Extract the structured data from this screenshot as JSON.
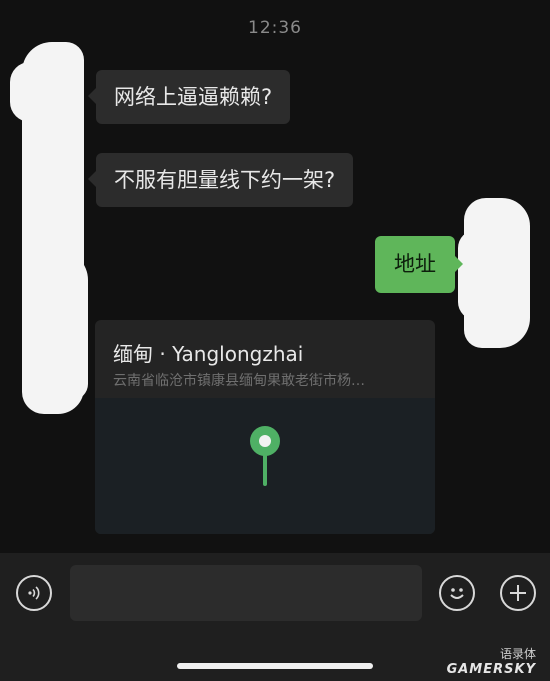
{
  "status_bar": {
    "time": "12:36"
  },
  "messages": [
    {
      "side": "left",
      "text": "网络上逼逼赖赖?"
    },
    {
      "side": "left",
      "text": "不服有胆量线下约一架?"
    },
    {
      "side": "right",
      "text": "地址"
    }
  ],
  "location_card": {
    "title": "缅甸 · Yanglongzhai",
    "address": "云南省临沧市镇康县缅甸果敢老街市杨…"
  },
  "input_bar": {
    "voice_icon": "voice-icon",
    "emoji_icon": "emoji-icon",
    "plus_icon": "plus-icon"
  },
  "watermark": {
    "account": "语录体",
    "brand": "GAMERSKY"
  },
  "colors": {
    "background": "#111111",
    "bubble_other": "#2c2c2c",
    "bubble_self": "#5fb65a",
    "pin": "#4fb065"
  }
}
